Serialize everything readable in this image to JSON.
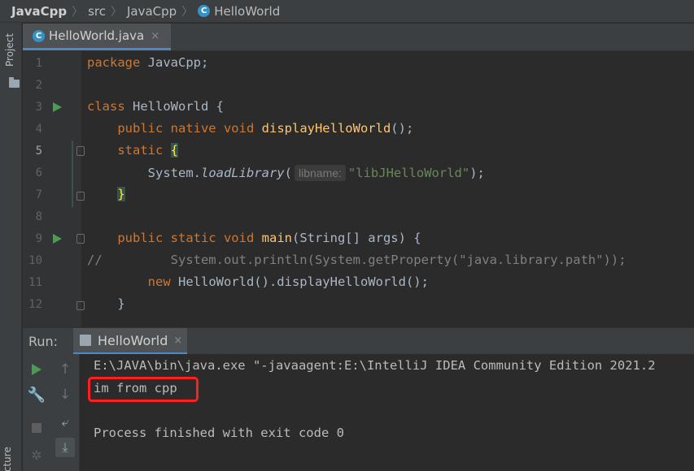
{
  "breadcrumb": {
    "project": "JavaCpp",
    "folder": "src",
    "package": "JavaCpp",
    "file": "HelloWorld",
    "class_icon_glyph": "C"
  },
  "sidebar": {
    "project_label": "Project",
    "structure_label": "Structure"
  },
  "editor": {
    "tab_label": "HelloWorld.java",
    "tab_close": "×",
    "lines": [
      {
        "n": "1"
      },
      {
        "n": "2"
      },
      {
        "n": "3"
      },
      {
        "n": "4"
      },
      {
        "n": "5"
      },
      {
        "n": "6"
      },
      {
        "n": "7"
      },
      {
        "n": "8"
      },
      {
        "n": "9"
      },
      {
        "n": "10"
      },
      {
        "n": "11"
      },
      {
        "n": "12"
      }
    ],
    "tokens": {
      "l1_kw": "package",
      "l1_rest": " JavaCpp;",
      "l3_kw": "class",
      "l3_rest": " HelloWorld {",
      "l4_kw": "public native void",
      "l4_fn": "displayHelloWorld",
      "l4_rest": "();",
      "l5_kw": "static",
      "l5_brace": "{",
      "l6_a": "System.",
      "l6_method": "loadLibrary",
      "l6_paren": "(",
      "l6_hint": "libname:",
      "l6_str": "\"libJHelloWorld\"",
      "l6_end": ");",
      "l7_brace": "}",
      "l9_kw": "public static void",
      "l9_fn": "main",
      "l9_rest": "(String[] args) {",
      "l10_comment": "//         System.out.println(System.getProperty(\"java.library.path\"));",
      "l11_kw": "new",
      "l11_rest": " HelloWorld().displayHelloWorld();",
      "l12_brace": "}"
    }
  },
  "run_panel": {
    "label": "Run:",
    "tab_label": "HelloWorld",
    "tab_close": "×",
    "console": [
      "E:\\JAVA\\bin\\java.exe \"-javaagent:E:\\IntelliJ IDEA Community Edition 2021.2",
      "im from cpp",
      "",
      "Process finished with exit code 0"
    ]
  },
  "colors": {
    "accent": "#4a88c7",
    "keyword": "#cc7832",
    "function": "#ffc66d",
    "string": "#6a8759",
    "run_green": "#499c54",
    "annotation_red": "#ff1f1f"
  }
}
